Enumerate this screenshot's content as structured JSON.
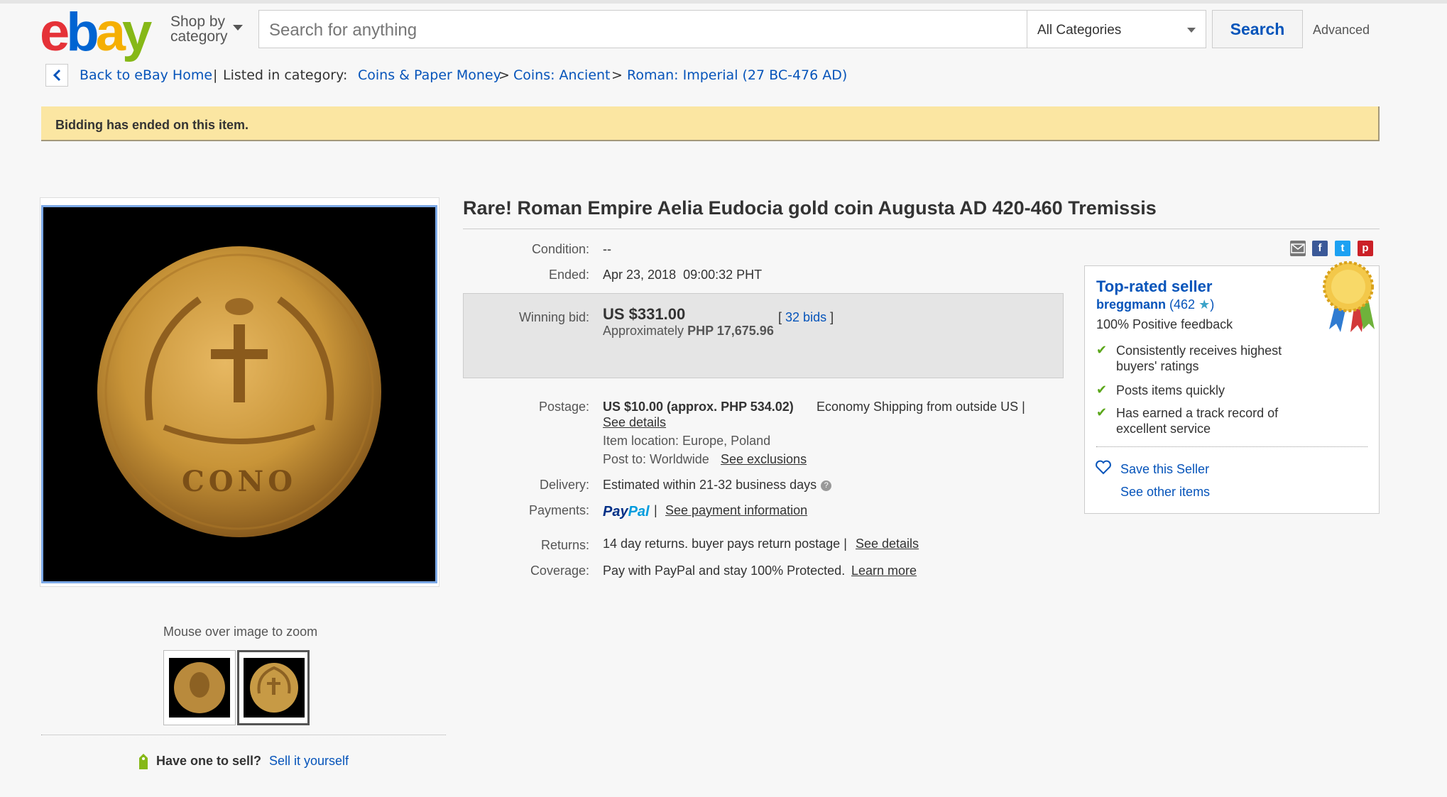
{
  "header": {
    "logo": {
      "e": "e",
      "b": "b",
      "a": "a",
      "y": "y"
    },
    "shop_by_line1": "Shop by",
    "shop_by_line2": "category",
    "search_placeholder": "Search for anything",
    "category": "All Categories",
    "search_button": "Search",
    "advanced": "Advanced"
  },
  "breadcrumb": {
    "back": "Back to eBay Home",
    "separator": "|",
    "listed_in": "Listed in category:",
    "crumb1": "Coins & Paper Money",
    "crumb2": "Coins: Ancient",
    "crumb3": "Roman: Imperial (27 BC-476 AD)",
    "arrow": ">"
  },
  "notice": "Bidding has ended on this item.",
  "image": {
    "zoom_hint": "Mouse over image to zoom",
    "coin_inscription": "CONO"
  },
  "sell": {
    "question": "Have one to sell?",
    "link": "Sell it yourself"
  },
  "item": {
    "title": "Rare! Roman Empire Aelia Eudocia gold coin Augusta AD 420-460 Tremissis",
    "condition_label": "Condition:",
    "condition_value": "--",
    "ended_label": "Ended:",
    "ended_value": "Apr 23, 2018  09:00:32 PHT",
    "winning_bid_label": "Winning bid:",
    "winning_bid": "US $331.00",
    "approx_prefix": "Approximately",
    "approx_value": "PHP 17,675.96",
    "bids_open": "[",
    "bids": "32 bids",
    "bids_close": "]",
    "postage_label": "Postage:",
    "postage_value": "US $10.00 (approx. PHP 534.02)",
    "postage_method": "Economy Shipping from outside US |",
    "postage_details": "See details",
    "item_location": "Item location: Europe, Poland",
    "post_to": "Post to: Worldwide",
    "see_exclusions": "See exclusions",
    "delivery_label": "Delivery:",
    "delivery_value": "Estimated within 21-32 business days",
    "payments_label": "Payments:",
    "paypal_p1": "Pay",
    "paypal_p2": "Pal",
    "payment_sep": "|",
    "payment_info": "See payment information",
    "returns_label": "Returns:",
    "returns_value": "14 day returns. buyer pays return postage |",
    "returns_details": "See details",
    "coverage_label": "Coverage:",
    "coverage_value": "Pay with PayPal and stay 100% Protected.",
    "learn_more": "Learn more"
  },
  "seller": {
    "badge": "Top-rated seller",
    "name": "breggmann",
    "score": "(462",
    "score_close": ")",
    "feedback": "100% Positive feedback",
    "points": [
      "Consistently receives highest buyers' ratings",
      "Posts items quickly",
      "Has earned a track record of excellent service"
    ],
    "save": "Save this Seller",
    "other": "See other items"
  },
  "colors": {
    "link": "#0654ba",
    "notice_bg": "#fbe6a2",
    "check": "#5ba71b"
  },
  "icons": [
    "back-arrow-icon",
    "caret-down-icon",
    "email-icon",
    "facebook-icon",
    "twitter-icon",
    "pinterest-icon",
    "info-icon",
    "check-icon",
    "heart-icon",
    "ribbon-icon",
    "price-tag-icon"
  ]
}
